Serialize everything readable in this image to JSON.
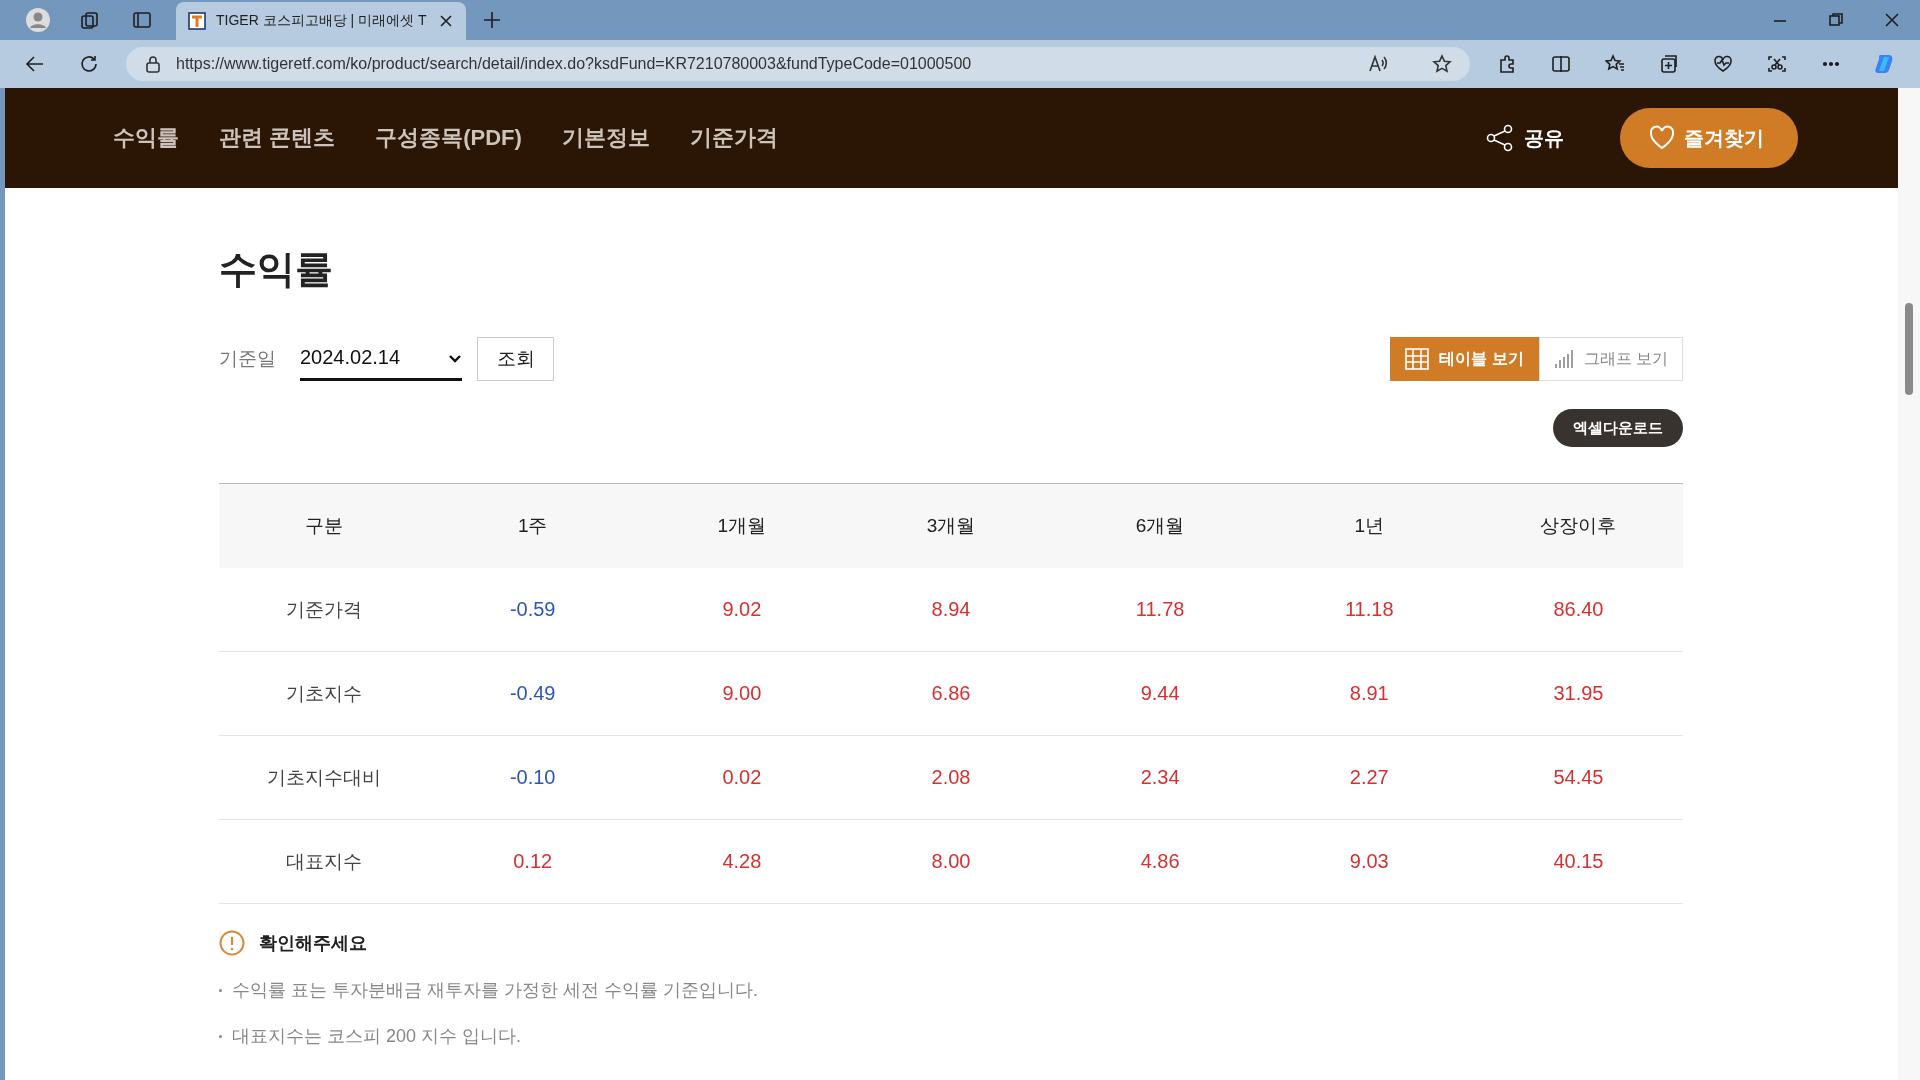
{
  "browser": {
    "tab_title": "TIGER 코스피고배당 | 미래에셋 T",
    "url": "https://www.tigeretf.com/ko/product/search/detail/index.do?ksdFund=KR7210780003&fundTypeCode=01000500"
  },
  "site_nav": {
    "items": [
      "수익률",
      "관련 콘텐츠",
      "구성종목(PDF)",
      "기본정보",
      "기준가격"
    ],
    "share": "공유",
    "favorite": "즐겨찾기"
  },
  "section": {
    "title": "수익률",
    "date_label": "기준일",
    "date_value": "2024.02.14",
    "search_button": "조회",
    "view_toggle": [
      {
        "label": "테이블 보기",
        "kind": "table",
        "selected": true
      },
      {
        "label": "그래프 보기",
        "kind": "graph",
        "selected": false
      }
    ],
    "excel_button": "엑셀다운로드"
  },
  "table": {
    "columns": [
      "구분",
      "1주",
      "1개월",
      "3개월",
      "6개월",
      "1년",
      "상장이후"
    ],
    "rows": [
      {
        "cells": [
          {
            "value": "기준가격"
          },
          {
            "value": "-0.59",
            "color": "#2e55b8"
          },
          {
            "value": "9.02",
            "color": "#d73030"
          },
          {
            "value": "8.94",
            "color": "#d73030"
          },
          {
            "value": "11.78",
            "color": "#d73030"
          },
          {
            "value": "11.18",
            "color": "#d73030"
          },
          {
            "value": "86.40",
            "color": "#d73030"
          }
        ]
      },
      {
        "cells": [
          {
            "value": "기초지수"
          },
          {
            "value": "-0.49",
            "color": "#2e55b8"
          },
          {
            "value": "9.00",
            "color": "#d73030"
          },
          {
            "value": "6.86",
            "color": "#d73030"
          },
          {
            "value": "9.44",
            "color": "#d73030"
          },
          {
            "value": "8.91",
            "color": "#d73030"
          },
          {
            "value": "31.95",
            "color": "#d73030"
          }
        ]
      },
      {
        "cells": [
          {
            "value": "기초지수대비"
          },
          {
            "value": "-0.10",
            "color": "#2e55b8"
          },
          {
            "value": "0.02",
            "color": "#d73030"
          },
          {
            "value": "2.08",
            "color": "#d73030"
          },
          {
            "value": "2.34",
            "color": "#d73030"
          },
          {
            "value": "2.27",
            "color": "#d73030"
          },
          {
            "value": "54.45",
            "color": "#d73030"
          }
        ]
      },
      {
        "cells": [
          {
            "value": "대표지수"
          },
          {
            "value": "0.12",
            "color": "#d73030"
          },
          {
            "value": "4.28",
            "color": "#d73030"
          },
          {
            "value": "8.00",
            "color": "#d73030"
          },
          {
            "value": "4.86",
            "color": "#d73030"
          },
          {
            "value": "9.03",
            "color": "#d73030"
          },
          {
            "value": "40.15",
            "color": "#d73030"
          }
        ]
      }
    ]
  },
  "notice": {
    "title": "확인해주세요",
    "items": [
      "수익률 표는 투자분배금 재투자를 가정한 세전 수익률 기준입니다.",
      "대표지수는 코스피 200 지수 입니다."
    ]
  }
}
